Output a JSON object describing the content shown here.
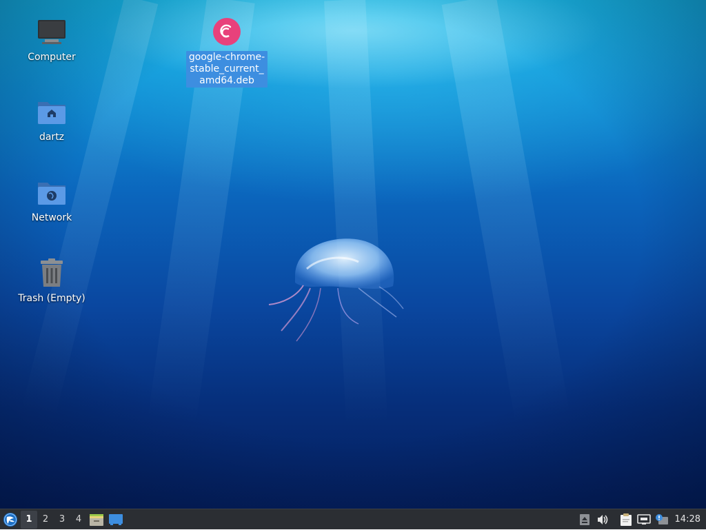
{
  "desktop": {
    "icons": [
      {
        "label": "Computer",
        "icon": "computer-icon"
      },
      {
        "label": "dartz",
        "icon": "home-folder-icon"
      },
      {
        "label": "Network",
        "icon": "network-folder-icon"
      },
      {
        "label": "Trash (Empty)",
        "icon": "trash-icon"
      },
      {
        "label": "google-chrome-stable_current_amd64.deb",
        "icon": "debian-package-icon",
        "selected": true
      }
    ]
  },
  "taskbar": {
    "start_icon": "lubuntu-start-icon",
    "workspaces": [
      "1",
      "2",
      "3",
      "4"
    ],
    "active_workspace": "1",
    "launchers": [
      {
        "icon": "file-manager-icon"
      },
      {
        "icon": "show-desktop-icon"
      }
    ],
    "tray": [
      {
        "icon": "arrow-up-icon"
      },
      {
        "icon": "volume-icon"
      },
      {
        "icon": "clipboard-icon"
      },
      {
        "icon": "network-wired-icon"
      },
      {
        "icon": "update-notifier-icon"
      }
    ],
    "clock": "14:28"
  },
  "colors": {
    "taskbar_bg": "#2b2e33",
    "selection": "#3d8ee0",
    "debian_red": "#e8417b"
  }
}
